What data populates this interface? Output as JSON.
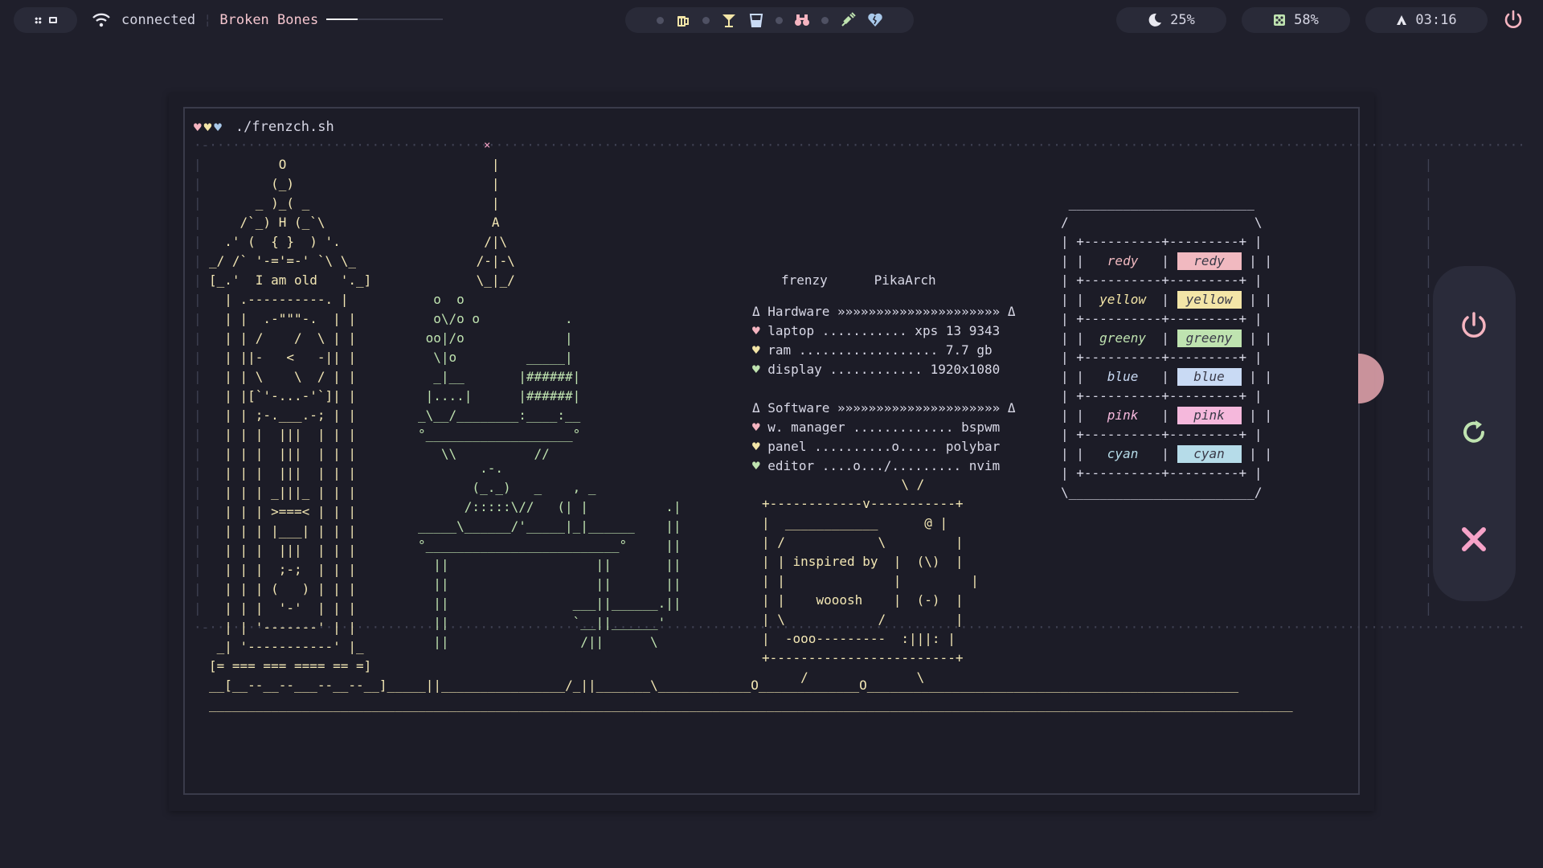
{
  "topbar": {
    "network_status": "connected",
    "song_title": "Broken Bones",
    "song_progress": 0.27,
    "moon_value": "25%",
    "cpu_value": "58%",
    "time_value": "03:16",
    "icons": [
      "beer-icon",
      "cocktail-icon",
      "glass-icon",
      "binoculars-icon",
      "syringe-icon",
      "heart-broken-icon"
    ]
  },
  "terminal": {
    "title_hearts": [
      "pink-heart-icon",
      "yellow-heart-icon",
      "blue-heart-icon"
    ],
    "command": "./frenzch.sh",
    "user": "frenzy",
    "host": "PikaArch",
    "hardware_header": "Δ Hardware »»»»»»»»»»»»»»»»»»»»» Δ",
    "software_header": "Δ Software »»»»»»»»»»»»»»»»»»»»» Δ",
    "hardware": [
      {
        "text": "laptop ........... xps 13 9343"
      },
      {
        "text": "ram .................. 7.7 gb"
      },
      {
        "text": "display ............ 1920x1080"
      }
    ],
    "software": [
      {
        "text": "w. manager ............. bspwm"
      },
      {
        "text": "panel ..........o..... polybar"
      },
      {
        "text": "editor ....o.../......... nvim"
      }
    ],
    "tv_text_1": "inspired by",
    "tv_text_2": "wooosh",
    "tower_label": "I am old",
    "swatches": [
      {
        "name": "redy",
        "color": "#f1b9c0"
      },
      {
        "name": "yellow",
        "color": "#f3e5a7"
      },
      {
        "name": "greeny",
        "color": "#bfe3b0"
      },
      {
        "name": "blue",
        "color": "#c9daf4"
      },
      {
        "name": "pink",
        "color": "#f5b8dc"
      },
      {
        "name": "cyan",
        "color": "#b6dce9"
      }
    ]
  },
  "colors": {
    "background": "#1f1f2b",
    "pink": "#f5b4c0",
    "yellow": "#f3e5a7",
    "green": "#bfe3b0",
    "blue": "#a9c9ea",
    "accent_x": "#f6a3c8"
  },
  "power_menu": {
    "buttons": [
      "power-icon",
      "restart-icon",
      "close-icon"
    ]
  }
}
